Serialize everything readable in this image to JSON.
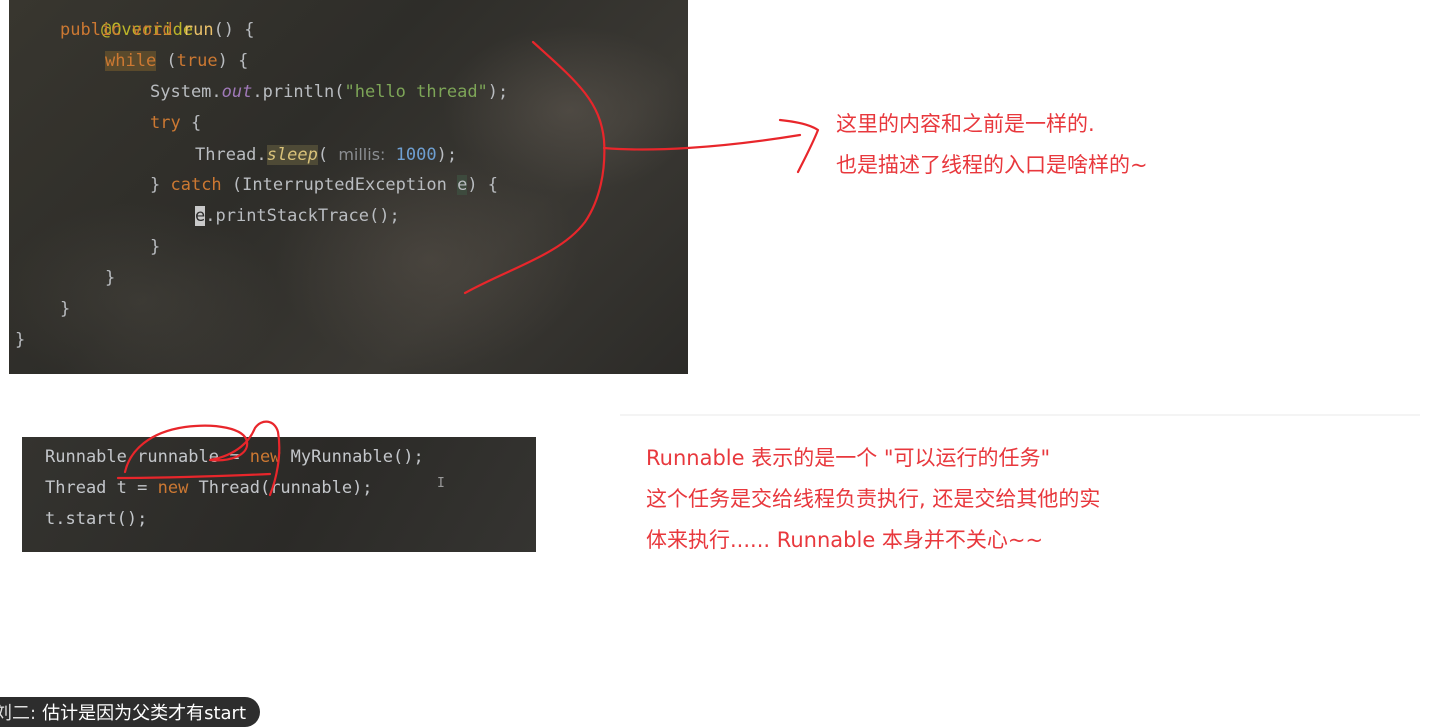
{
  "code_block_1": {
    "lines": [
      {
        "text": "@Override"
      },
      {
        "kw": "public void",
        "name": "run",
        "rest": "() {"
      },
      {
        "kw": "while",
        "rest1": " (",
        "kw2": "true",
        "rest2": ") {"
      },
      {
        "pre": "System.",
        "field": "out",
        "mid": ".println(",
        "str": "\"hello thread\"",
        "post": ");"
      },
      {
        "kw": "try",
        "rest": " {"
      },
      {
        "pre": "Thread.",
        "method": "sleep",
        "mid": "( ",
        "hint": "millis:",
        "num": "1000",
        "post": ");"
      },
      {
        "pre": "} ",
        "kw": "catch",
        "mid": " (InterruptedException ",
        "param": "e",
        "post": ") {"
      },
      {
        "caret": "e",
        "rest": ".printStackTrace();"
      },
      {
        "text": "}"
      },
      {
        "text": "}"
      },
      {
        "text": "}"
      },
      {
        "text": "}"
      }
    ]
  },
  "code_block_2": {
    "line1": {
      "pre": "Runnable runnable = ",
      "kw": "new",
      "post": " MyRunnable();"
    },
    "line2": {
      "pre": "Thread t = ",
      "kw": "new",
      "post": " Thread(runnable);"
    },
    "line3": {
      "text": "t.start();"
    }
  },
  "annotation_1": {
    "line1": "这里的内容和之前是一样的.",
    "line2": "也是描述了线程的入口是啥样的~"
  },
  "annotation_2": {
    "line1": "Runnable 表示的是一个 \"可以运行的任务\"",
    "line2": "这个任务是交给线程负责执行, 还是交给其他的实",
    "line3": "体来执行...... Runnable 本身并不关心~~"
  },
  "chat": {
    "name": "刘二:",
    "message": "估计是因为父类才有start"
  },
  "colors": {
    "annotation": "#e8383d",
    "keyword": "#cc7832",
    "string": "#7da557",
    "number": "#6e9fd1"
  }
}
